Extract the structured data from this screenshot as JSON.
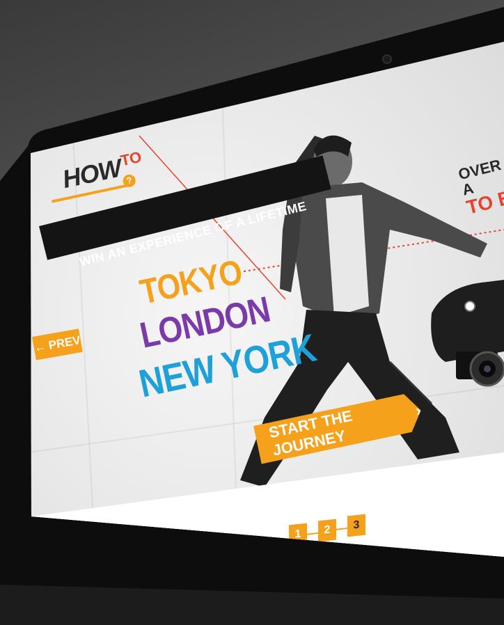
{
  "logo": {
    "how": "HOW",
    "to": "TO",
    "badge": "?"
  },
  "banner": {
    "text": "WIN AN EXPERIENCE OF A LIFETIME"
  },
  "cities": [
    {
      "name": "TOKYO",
      "color": "#f5a11c"
    },
    {
      "name": "LONDON",
      "color": "#7a3aa8"
    },
    {
      "name": "NEW YORK",
      "color": "#1ea0d8"
    }
  ],
  "prev": {
    "arrow": "←",
    "label": "PREV"
  },
  "cta": {
    "label": "START THE JOURNEY",
    "chevron": "›"
  },
  "teaser": {
    "line1": "OVER A",
    "line2": "TO B"
  },
  "pagination": {
    "pages": [
      "1",
      "2",
      "3"
    ],
    "current": "3"
  },
  "colors": {
    "accent": "#f5a11c",
    "logo_red": "#e8432a",
    "banner_bg": "#141414"
  },
  "icons": [
    "camera-icon",
    "arrow-left-icon",
    "chevron-right-icon"
  ]
}
